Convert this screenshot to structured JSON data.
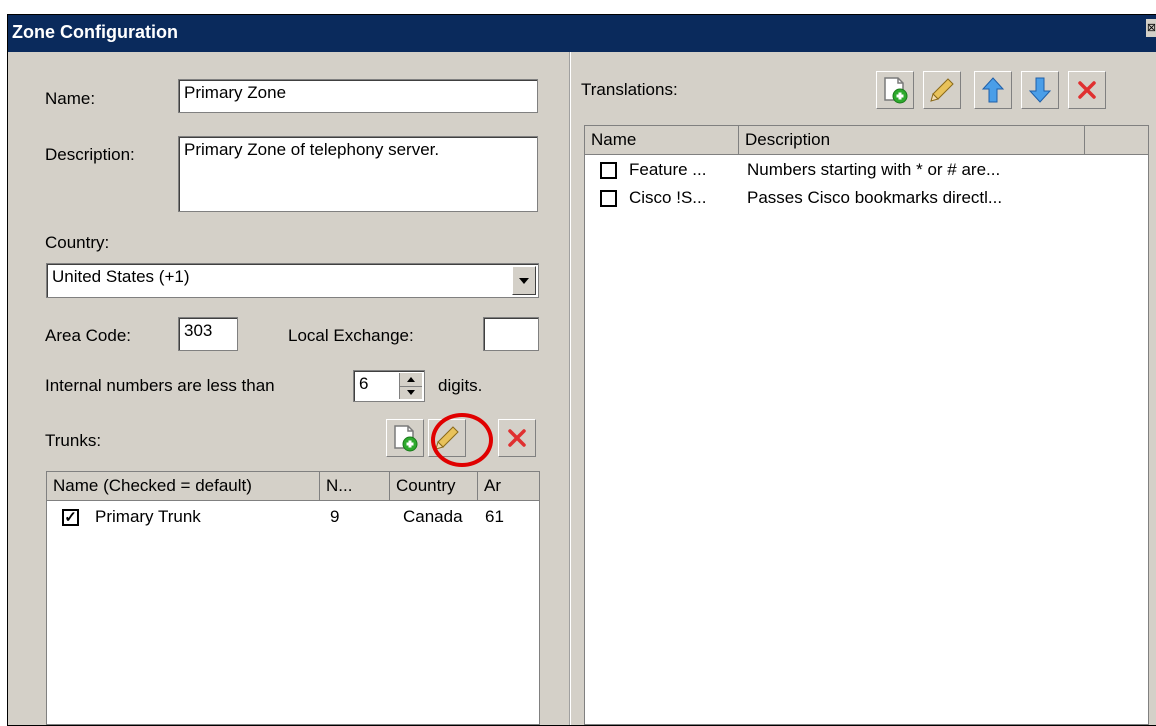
{
  "window": {
    "title": "Zone Configuration",
    "close_glyph": "⊠"
  },
  "form": {
    "name_label": "Name:",
    "name_value": "Primary Zone",
    "description_label": "Description:",
    "description_value": "Primary Zone of telephony server.",
    "country_label": "Country:",
    "country_value": "United States (+1)",
    "area_code_label": "Area Code:",
    "area_code_value": "303",
    "local_exchange_label": "Local Exchange:",
    "local_exchange_value": "",
    "internal_prefix": "Internal numbers are less than",
    "internal_digits_value": "6",
    "internal_suffix": "digits."
  },
  "trunks": {
    "label": "Trunks:",
    "columns": [
      "Name (Checked = default)",
      "N...",
      "Country",
      "Ar"
    ],
    "rows": [
      {
        "checked": true,
        "check_glyph": "✓",
        "name": "Primary Trunk",
        "number": "9",
        "country": "Canada",
        "area": "61"
      }
    ]
  },
  "translations": {
    "label": "Translations:",
    "columns": [
      "Name",
      "Description"
    ],
    "rows": [
      {
        "checked": false,
        "name": "Feature ...",
        "description": "Numbers starting with * or # are..."
      },
      {
        "checked": false,
        "name": "Cisco !S...",
        "description": "Passes Cisco bookmarks directl..."
      }
    ]
  },
  "colors": {
    "titlebar": "#0a2a5c",
    "dialog_bg": "#d4d0c8",
    "highlight_circle": "#e00000"
  }
}
